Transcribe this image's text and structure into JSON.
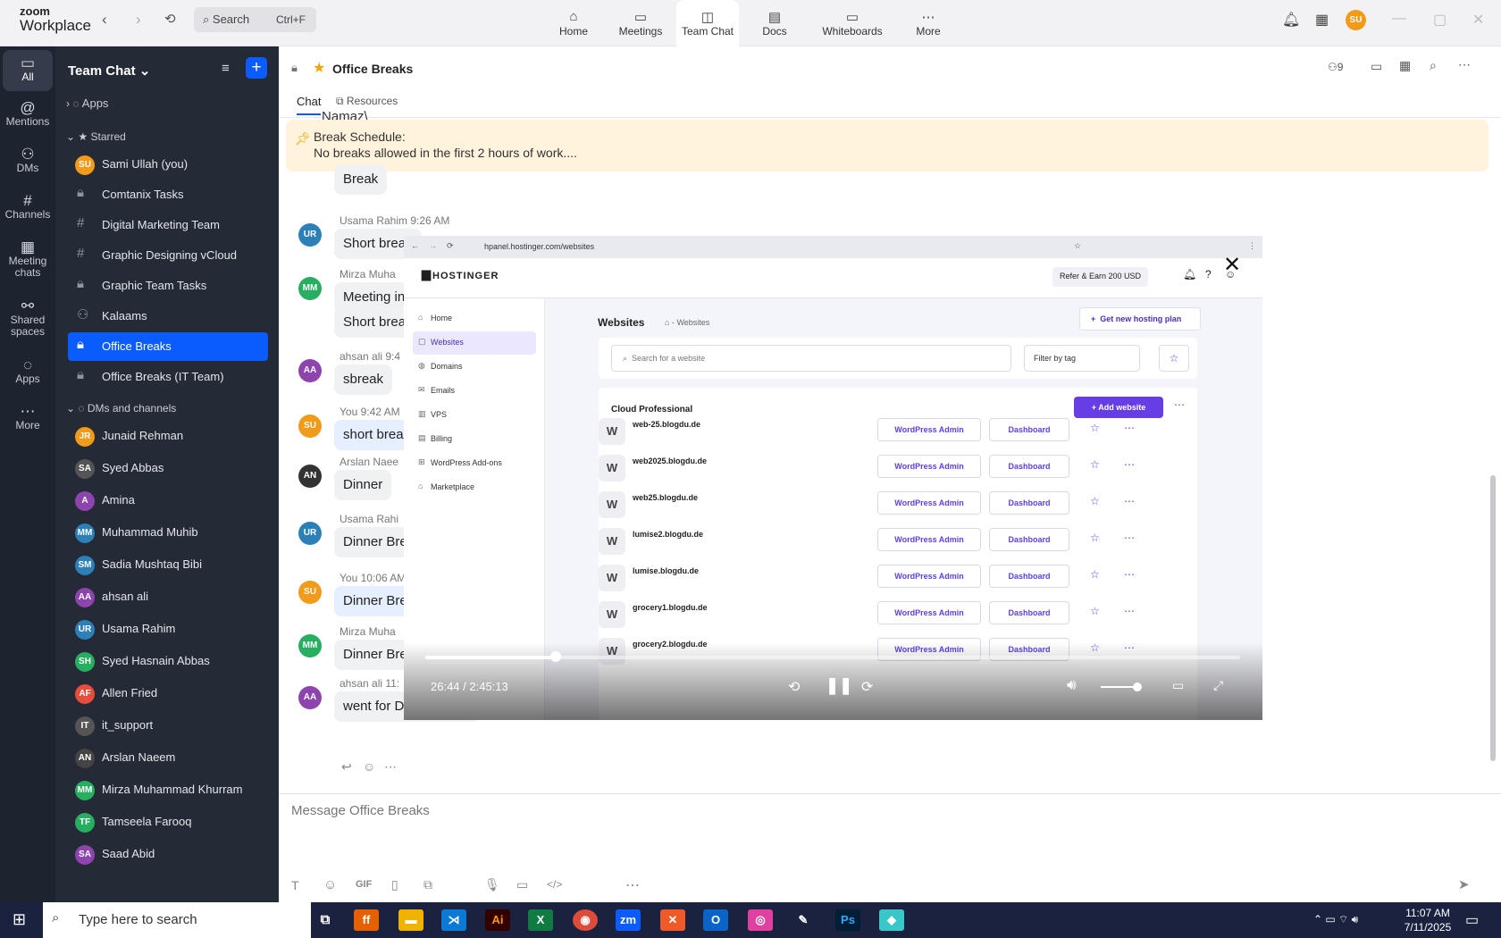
{
  "topbar": {
    "brand_line1": "zoom",
    "brand_line2": "Workplace",
    "search_placeholder": "Search",
    "search_shortcut": "Ctrl+F",
    "tabs": [
      {
        "label": "Home"
      },
      {
        "label": "Meetings"
      },
      {
        "label": "Team Chat"
      },
      {
        "label": "Docs"
      },
      {
        "label": "Whiteboards"
      },
      {
        "label": "More"
      }
    ],
    "user_initials": "SU"
  },
  "rail": [
    {
      "label": "All"
    },
    {
      "label": "Mentions"
    },
    {
      "label": "DMs"
    },
    {
      "label": "Channels"
    },
    {
      "label": "Meeting chats"
    },
    {
      "label": "Shared spaces"
    },
    {
      "label": "Apps"
    },
    {
      "label": "More"
    }
  ],
  "sidebar": {
    "title": "Team Chat",
    "apps_label": "Apps",
    "starred_label": "Starred",
    "dms_label": "DMs and channels",
    "starred": [
      {
        "label": "Sami Ullah (you)",
        "initials": "SU",
        "color": "#f29a1a"
      },
      {
        "label": "Comtanix Tasks"
      },
      {
        "label": "Digital Marketing Team"
      },
      {
        "label": "Graphic Designing vCloud"
      },
      {
        "label": "Graphic Team Tasks"
      },
      {
        "label": "Kalaams"
      },
      {
        "label": "Office Breaks"
      },
      {
        "label": "Office Breaks (IT Team)"
      }
    ],
    "dms": [
      {
        "label": "Junaid Rehman",
        "initials": "JR",
        "color": "#f29a1a"
      },
      {
        "label": "Syed Abbas",
        "initials": "SA",
        "color": "#555"
      },
      {
        "label": "Amina",
        "initials": "A",
        "color": "#8e44ad"
      },
      {
        "label": "Muhammad Muhib",
        "initials": "MM",
        "color": "#2d7fb8"
      },
      {
        "label": "Sadia Mushtaq Bibi",
        "initials": "SM",
        "color": "#2d7fb8"
      },
      {
        "label": "ahsan ali",
        "initials": "AA",
        "color": "#8e44ad"
      },
      {
        "label": "Usama Rahim",
        "initials": "UR",
        "color": "#2d7fb8"
      },
      {
        "label": "Syed Hasnain Abbas",
        "initials": "SH",
        "color": "#27ae60"
      },
      {
        "label": "Allen Fried",
        "initials": "AF",
        "color": "#e74c3c"
      },
      {
        "label": "it_support",
        "initials": "IT",
        "color": "#555"
      },
      {
        "label": "Arslan Naeem",
        "initials": "AN",
        "color": "#444"
      },
      {
        "label": "Mirza Muhammad Khurram",
        "initials": "MM",
        "color": "#27ae60"
      },
      {
        "label": "Tamseela Farooq",
        "initials": "TF",
        "color": "#27ae60"
      },
      {
        "label": "Saad Abid",
        "initials": "SA",
        "color": "#8e44ad"
      }
    ]
  },
  "channel": {
    "title": "Office Breaks",
    "tab_chat": "Chat",
    "tab_resources": "Resources",
    "member_count": "9",
    "pinned_title": "Break Schedule:",
    "pinned_text": "No breaks allowed in the first 2 hours of work....",
    "top_partial": "Namaz\\"
  },
  "messages": [
    {
      "initials": "",
      "name": "",
      "text": "Break",
      "color": "#c0392b",
      "me": false
    },
    {
      "initials": "UR",
      "name": "Usama Rahim 9:26 AM",
      "text": "Short break",
      "color": "#2d7fb8",
      "me": false
    },
    {
      "initials": "MM",
      "name": "Mirza Muha",
      "text": "Meeting in",
      "color": "#27ae60",
      "me": false
    },
    {
      "initials": "",
      "name": "",
      "text": "Short brea",
      "color": "#27ae60",
      "me": false
    },
    {
      "initials": "AA",
      "name": "ahsan ali 9:4",
      "text": "sbreak",
      "color": "#8e44ad",
      "me": false
    },
    {
      "initials": "SU",
      "name": "You 9:42 AM",
      "text": "short brea",
      "color": "#f29a1a",
      "me": true
    },
    {
      "initials": "AN",
      "name": "Arslan Naee",
      "text": "Dinner",
      "color": "#333",
      "me": false
    },
    {
      "initials": "UR",
      "name": "Usama Rahi",
      "text": "Dinner Bre",
      "color": "#2d7fb8",
      "me": false
    },
    {
      "initials": "SU",
      "name": "You 10:06 AM",
      "text": "Dinner Brea",
      "color": "#f29a1a",
      "me": true
    },
    {
      "initials": "MM",
      "name": "Mirza Muha",
      "text": "Dinner Bre",
      "color": "#27ae60",
      "me": false
    },
    {
      "initials": "AA",
      "name": "ahsan ali 11:",
      "text": "went for Dinner break",
      "color": "#8e44ad",
      "me": false
    }
  ],
  "video": {
    "url": "hpanel.hostinger.com/websites",
    "brand": "HOSTINGER",
    "refer": "Refer & Earn 200 USD",
    "page_title": "Websites",
    "crumb": "Websites",
    "new_plan": "Get new hosting plan",
    "search_placeholder": "Search for a website",
    "filter": "Filter by tag",
    "section": "Cloud Professional",
    "add": "Add website",
    "wp_admin": "WordPress Admin",
    "dashboard": "Dashboard",
    "time": "26:44 / 2:45:13",
    "progress": 0.16,
    "nav": [
      {
        "label": "Home"
      },
      {
        "label": "Websites"
      },
      {
        "label": "Domains"
      },
      {
        "label": "Emails"
      },
      {
        "label": "VPS"
      },
      {
        "label": "Billing"
      },
      {
        "label": "WordPress Add-ons"
      },
      {
        "label": "Marketplace"
      }
    ],
    "sites": [
      {
        "name": "web-25.blogdu.de"
      },
      {
        "name": "web2025.blogdu.de"
      },
      {
        "name": "web25.blogdu.de"
      },
      {
        "name": "lumise2.blogdu.de"
      },
      {
        "name": "lumise.blogdu.de"
      },
      {
        "name": "grocery1.blogdu.de"
      },
      {
        "name": "grocery2.blogdu.de"
      }
    ]
  },
  "compose": {
    "placeholder": "Message Office Breaks"
  },
  "taskbar": {
    "search": "Type here to search",
    "time": "11:07 AM",
    "date": "7/11/2025"
  }
}
